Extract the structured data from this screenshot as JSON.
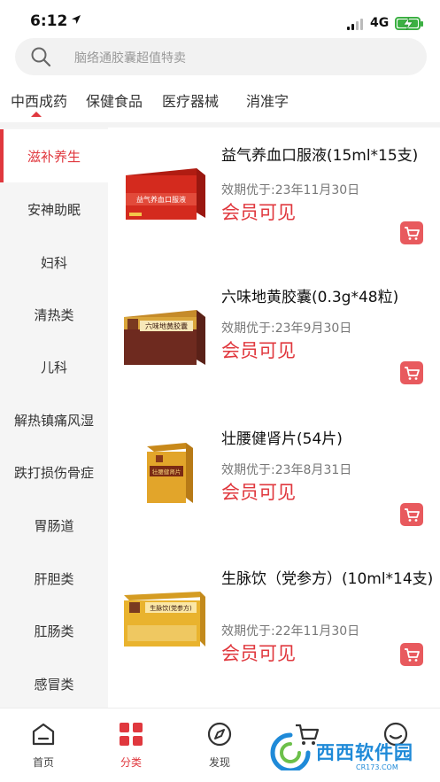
{
  "status_bar": {
    "time": "6:12",
    "network": "4G"
  },
  "search": {
    "placeholder": "脑络通胶囊超值特卖"
  },
  "top_tabs": [
    {
      "label": "中西成药",
      "active": true
    },
    {
      "label": "保健食品",
      "active": false
    },
    {
      "label": "医疗器械",
      "active": false
    },
    {
      "label": "消准字",
      "active": false
    }
  ],
  "sidebar": {
    "items": [
      {
        "label": "滋补养生",
        "active": true
      },
      {
        "label": "安神助眠",
        "active": false
      },
      {
        "label": "妇科",
        "active": false
      },
      {
        "label": "清热类",
        "active": false
      },
      {
        "label": "儿科",
        "active": false
      },
      {
        "label": "解热镇痛风湿",
        "active": false
      },
      {
        "label": "跌打损伤骨症",
        "active": false
      },
      {
        "label": "胃肠道",
        "active": false
      },
      {
        "label": "肝胆类",
        "active": false
      },
      {
        "label": "肛肠类",
        "active": false
      },
      {
        "label": "感冒类",
        "active": false
      }
    ]
  },
  "products": [
    {
      "title": "益气养血口服液(15ml*15支)",
      "expiry": "效期优于:23年11月30日",
      "price": "会员可见",
      "box_label": "益气养血口服液",
      "box_color": "#d42a1e"
    },
    {
      "title": "六味地黄胶囊(0.3g*48粒)",
      "expiry": "效期优于:23年9月30日",
      "price": "会员可见",
      "box_label": "六味地黄胶囊",
      "box_color": "#6e2a1f"
    },
    {
      "title": "壮腰健肾片(54片)",
      "expiry": "效期优于:23年8月31日",
      "price": "会员可见",
      "box_label": "壮腰健肾片",
      "box_color": "#e2a52a"
    },
    {
      "title": "生脉饮（党参方）(10ml*14支)",
      "expiry": "效期优于:22年11月30日",
      "price": "会员可见",
      "box_label": "生脉饮(党参方)",
      "box_color": "#e9b32e"
    }
  ],
  "bottom_nav": [
    {
      "label": "首页",
      "icon": "home-icon",
      "active": false
    },
    {
      "label": "分类",
      "icon": "category-icon",
      "active": true
    },
    {
      "label": "发现",
      "icon": "compass-icon",
      "active": false
    },
    {
      "label": "",
      "icon": "cart-icon",
      "active": false
    },
    {
      "label": "",
      "icon": "profile-icon",
      "active": false
    }
  ],
  "watermark": {
    "text": "西西软件园",
    "sub": "CR173.COM"
  },
  "colors": {
    "accent": "#e0383e",
    "sidebar_bg": "#f5f5f5",
    "cart_button": "#e85a5e"
  }
}
